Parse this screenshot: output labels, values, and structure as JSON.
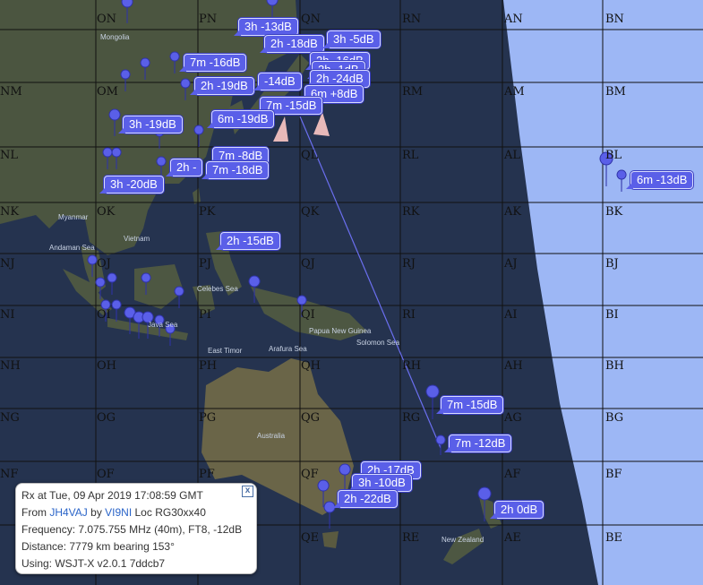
{
  "map": {
    "grid_labels": [
      {
        "id": "gl-on",
        "text": "ON"
      },
      {
        "id": "gl-pn",
        "text": "PN"
      },
      {
        "id": "gl-qn",
        "text": "QN"
      },
      {
        "id": "gl-rn",
        "text": "RN"
      },
      {
        "id": "gl-an",
        "text": "AN"
      },
      {
        "id": "gl-bn",
        "text": "BN"
      },
      {
        "id": "gl-nm",
        "text": "NM"
      },
      {
        "id": "gl-om",
        "text": "OM"
      },
      {
        "id": "gl-rm",
        "text": "RM"
      },
      {
        "id": "gl-am",
        "text": "AM"
      },
      {
        "id": "gl-bm",
        "text": "BM"
      },
      {
        "id": "gl-nl",
        "text": "NL"
      },
      {
        "id": "gl-ql",
        "text": "QL"
      },
      {
        "id": "gl-rl",
        "text": "RL"
      },
      {
        "id": "gl-al",
        "text": "AL"
      },
      {
        "id": "gl-bl",
        "text": "BL"
      },
      {
        "id": "gl-nk",
        "text": "NK"
      },
      {
        "id": "gl-ok",
        "text": "OK"
      },
      {
        "id": "gl-pk",
        "text": "PK"
      },
      {
        "id": "gl-qk",
        "text": "QK"
      },
      {
        "id": "gl-rk",
        "text": "RK"
      },
      {
        "id": "gl-ak",
        "text": "AK"
      },
      {
        "id": "gl-bk",
        "text": "BK"
      },
      {
        "id": "gl-nj",
        "text": "NJ"
      },
      {
        "id": "gl-oj",
        "text": "OJ"
      },
      {
        "id": "gl-pj",
        "text": "PJ"
      },
      {
        "id": "gl-qj",
        "text": "QJ"
      },
      {
        "id": "gl-rj",
        "text": "RJ"
      },
      {
        "id": "gl-aj",
        "text": "AJ"
      },
      {
        "id": "gl-bj",
        "text": "BJ"
      },
      {
        "id": "gl-ni",
        "text": "NI"
      },
      {
        "id": "gl-oi",
        "text": "OI"
      },
      {
        "id": "gl-pi",
        "text": "PI"
      },
      {
        "id": "gl-qi",
        "text": "QI"
      },
      {
        "id": "gl-ri",
        "text": "RI"
      },
      {
        "id": "gl-ai",
        "text": "AI"
      },
      {
        "id": "gl-bi",
        "text": "BI"
      },
      {
        "id": "gl-nh",
        "text": "NH"
      },
      {
        "id": "gl-oh",
        "text": "OH"
      },
      {
        "id": "gl-ph",
        "text": "PH"
      },
      {
        "id": "gl-qh",
        "text": "QH"
      },
      {
        "id": "gl-rh",
        "text": "RH"
      },
      {
        "id": "gl-ah",
        "text": "AH"
      },
      {
        "id": "gl-bh",
        "text": "BH"
      },
      {
        "id": "gl-ng",
        "text": "NG"
      },
      {
        "id": "gl-og",
        "text": "OG"
      },
      {
        "id": "gl-pg",
        "text": "PG"
      },
      {
        "id": "gl-qg",
        "text": "QG"
      },
      {
        "id": "gl-rg",
        "text": "RG"
      },
      {
        "id": "gl-ag",
        "text": "AG"
      },
      {
        "id": "gl-bg",
        "text": "BG"
      },
      {
        "id": "gl-nf",
        "text": "NF"
      },
      {
        "id": "gl-of",
        "text": "OF"
      },
      {
        "id": "gl-pf",
        "text": "PF"
      },
      {
        "id": "gl-qf",
        "text": "QF"
      },
      {
        "id": "gl-af",
        "text": "AF"
      },
      {
        "id": "gl-bf",
        "text": "BF"
      },
      {
        "id": "gl-qe",
        "text": "QE"
      },
      {
        "id": "gl-re",
        "text": "RE"
      },
      {
        "id": "gl-ae",
        "text": "AE"
      },
      {
        "id": "gl-be",
        "text": "BE"
      }
    ],
    "places": {
      "mongolia": "Mongolia",
      "myanmar": "Myanmar",
      "vietnam": "Vietnam",
      "andaman_sea": "Andaman Sea",
      "celebes_sea": "Celebes Sea",
      "java_sea": "Java Sea",
      "east_timor": "East Timor",
      "arafura_sea": "Arafura Sea",
      "papua_new_guinea": "Papua New Guinea",
      "solomon_sea": "Solomon Sea",
      "australia": "Australia",
      "new_zealand": "New Zealand"
    },
    "spot_labels": [
      {
        "id": "s1",
        "text": "3h -13dB"
      },
      {
        "id": "s2",
        "text": "2h -18dB"
      },
      {
        "id": "s3",
        "text": "3h -5dB"
      },
      {
        "id": "s4",
        "text": "7m -16dB"
      },
      {
        "id": "s5",
        "text": "2h -16dB"
      },
      {
        "id": "s6",
        "text": "2h -1dB"
      },
      {
        "id": "s7",
        "text": "2h -19dB"
      },
      {
        "id": "s8",
        "text": "-14dB"
      },
      {
        "id": "s9",
        "text": "2h -24dB"
      },
      {
        "id": "s10",
        "text": "6m +8dB"
      },
      {
        "id": "s11",
        "text": "7m -15dB"
      },
      {
        "id": "s12",
        "text": "3h -19dB"
      },
      {
        "id": "s13",
        "text": "6m -19dB"
      },
      {
        "id": "s14",
        "text": "7m -8dB"
      },
      {
        "id": "s15",
        "text": "2h -"
      },
      {
        "id": "s16",
        "text": "7m -18dB"
      },
      {
        "id": "s17",
        "text": "3h -20dB"
      },
      {
        "id": "s18",
        "text": "6m -13dB"
      },
      {
        "id": "s19",
        "text": "2h -15dB"
      },
      {
        "id": "s20",
        "text": "7m -15dB"
      },
      {
        "id": "s21",
        "text": "7m -12dB"
      },
      {
        "id": "s22",
        "text": "2h -17dB"
      },
      {
        "id": "s23",
        "text": "3h -10dB"
      },
      {
        "id": "s24",
        "text": "2h -22dB"
      },
      {
        "id": "s25",
        "text": "2h 0dB"
      }
    ]
  },
  "info": {
    "rx_at": "Rx at Tue, 09 Apr 2019 17:08:59 GMT",
    "from_prefix": "From ",
    "from_call": "JH4VAJ",
    "by_word": " by ",
    "by_call": "VI9NI",
    "loc": " Loc RG30xx40",
    "frequency": "Frequency: 7.075.755 MHz (40m), FT8, -12dB",
    "distance": "Distance: 7779 km bearing 153°",
    "using": "Using: WSJT-X v2.0.1 7ddcb7",
    "close_symbol": "x"
  },
  "colors": {
    "ocean": "#24324f",
    "land": "#4f5a45",
    "daylight": "#9db7f5",
    "marker": "#5a5fe8",
    "grid": "#111111"
  },
  "icons": {
    "marker": "map-pin-icon",
    "close": "close-icon"
  }
}
